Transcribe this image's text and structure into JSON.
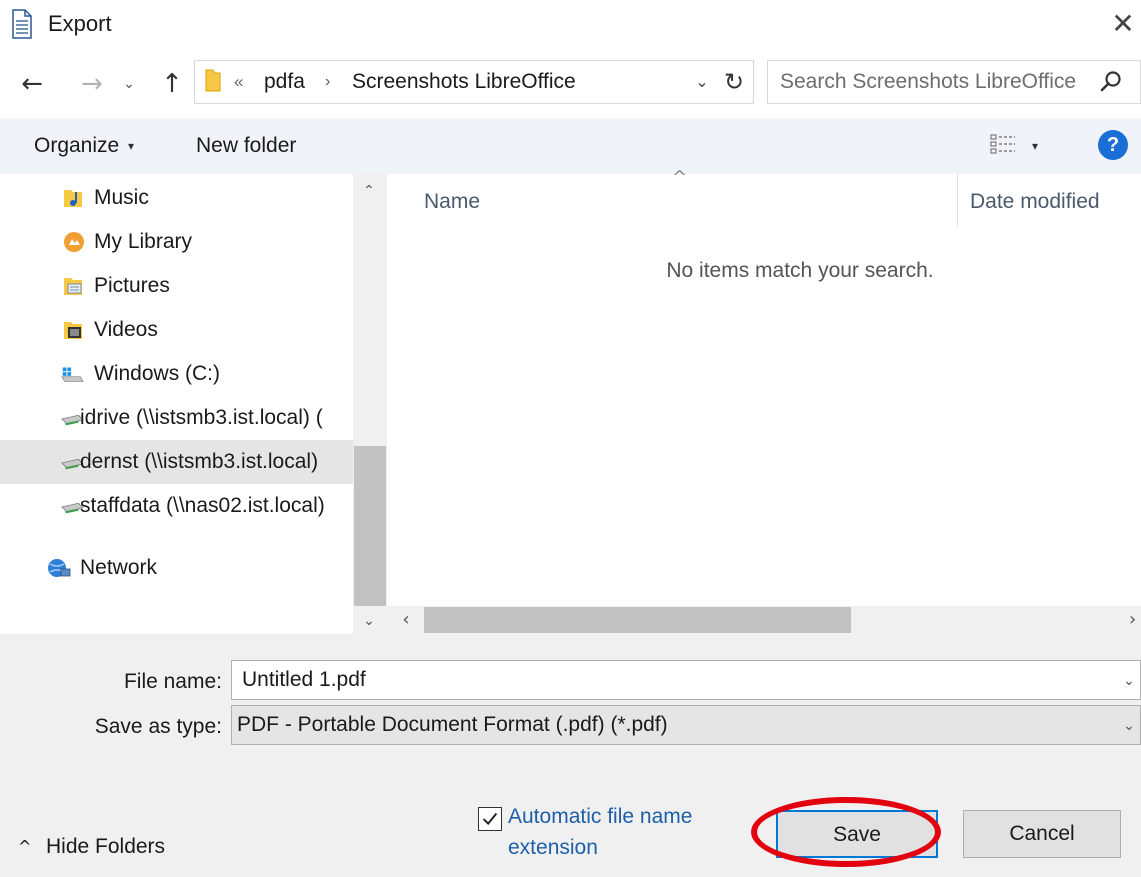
{
  "window": {
    "title": "Export",
    "close_glyph": "✕"
  },
  "nav": {
    "back_glyph": "←",
    "forward_glyph": "→",
    "recent_glyph": "⌄",
    "up_glyph": "↑",
    "refresh_glyph": "↻",
    "address_dropdown_glyph": "⌄"
  },
  "address": {
    "overflow_glyph": "«",
    "separator_glyph": "›",
    "breadcrumbs": [
      "pdfa",
      "Screenshots LibreOffice"
    ]
  },
  "search": {
    "placeholder": "Search Screenshots LibreOffice"
  },
  "toolbar": {
    "organize_label": "Organize",
    "caret": "▾",
    "new_folder_label": "New folder",
    "help_glyph": "?"
  },
  "sidebar": {
    "scroll_up_glyph": "⌃",
    "scroll_down_glyph": "⌄",
    "items": [
      {
        "label": "Music",
        "icon": "music-folder-icon"
      },
      {
        "label": "My Library",
        "icon": "library-icon"
      },
      {
        "label": "Pictures",
        "icon": "pictures-folder-icon"
      },
      {
        "label": "Videos",
        "icon": "videos-folder-icon"
      },
      {
        "label": "Windows (C:)",
        "icon": "windows-drive-icon"
      },
      {
        "label": "idrive (\\\\istsmb3.ist.local) (",
        "icon": "network-drive-icon"
      },
      {
        "label": "dernst (\\\\istsmb3.ist.local)",
        "icon": "network-drive-icon",
        "selected": true
      },
      {
        "label": "staffdata (\\\\nas02.ist.local)",
        "icon": "network-drive-icon"
      },
      {
        "label": "Network",
        "icon": "network-icon"
      }
    ]
  },
  "filelist": {
    "sort_glyph": "^",
    "columns": [
      "Name",
      "Date modified"
    ],
    "empty_message": "No items match your search.",
    "scroll_left_glyph": "‹",
    "scroll_right_glyph": "›"
  },
  "form": {
    "file_name_label": "File name:",
    "file_name_value": "Untitled 1.pdf",
    "save_as_type_label": "Save as type:",
    "save_as_type_value": "PDF - Portable Document Format (.pdf) (*.pdf)",
    "dropdown_glyph": "⌄"
  },
  "footer": {
    "hide_folders_glyph": "^",
    "hide_folders_label": "Hide Folders",
    "auto_extension_label": "Automatic file name extension",
    "auto_extension_checked": true,
    "save_label": "Save",
    "cancel_label": "Cancel"
  },
  "colors": {
    "toolbar_bg": "#f0f3f9",
    "accent_blue": "#0078d7",
    "link_blue": "#1d5fa8",
    "help_blue": "#1a6fd6",
    "highlight_red": "#e3000f",
    "selected_bg": "#e5e5e5",
    "bottom_pane_bg": "#f0f0f0"
  }
}
